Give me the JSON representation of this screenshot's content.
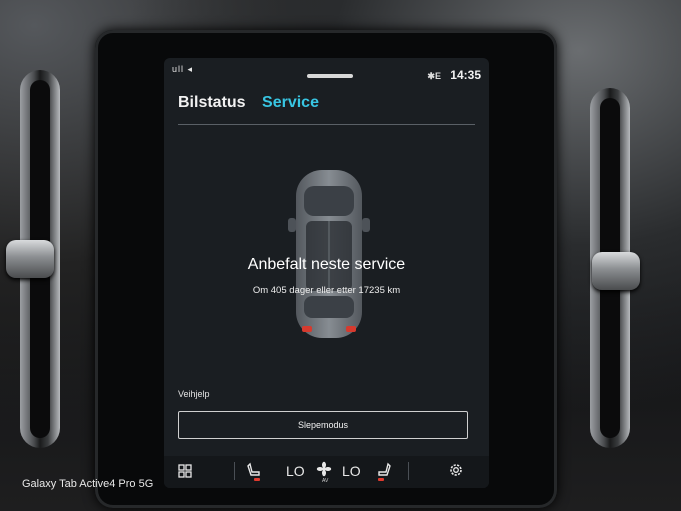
{
  "status_bar": {
    "signal_text": "ull ◂",
    "bluetooth_text": "✱E",
    "time": "14:35"
  },
  "tabs": [
    {
      "label": "Bilstatus",
      "active": false
    },
    {
      "label": "Service",
      "active": true
    }
  ],
  "service": {
    "title": "Anbefalt neste service",
    "subtitle": "Om 405 dager eller etter 17235 km"
  },
  "roadside": {
    "section_label": "Veihjelp",
    "tow_mode_label": "Slepemodus"
  },
  "climate": {
    "left_temp": "LO",
    "right_temp": "LO",
    "fan_label": "AV"
  },
  "photo": {
    "watermark": "Galaxy Tab Active4 Pro 5G"
  },
  "colors": {
    "accent": "#38c6e3",
    "heat_indicator": "#e03a2e",
    "screen_bg": "#1a1e22"
  },
  "icons": {
    "grid": "apps-grid-icon",
    "seat_left": "seat-heat-left-icon",
    "fan": "fan-icon",
    "seat_right": "seat-heat-right-icon",
    "settings": "gear-icon"
  }
}
